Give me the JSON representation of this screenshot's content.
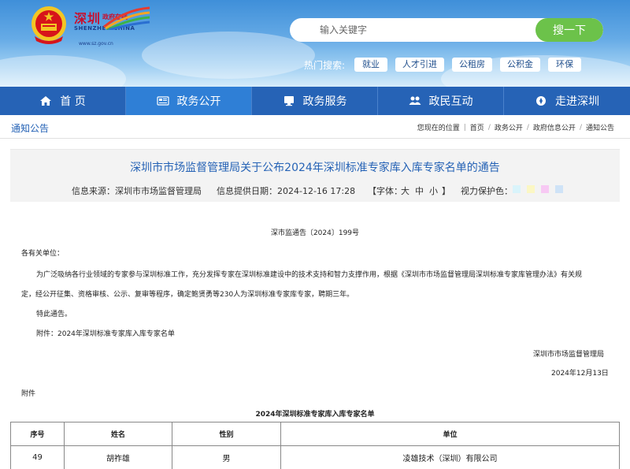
{
  "header": {
    "logo_cn": "深圳",
    "logo_cn_small": "政府在线",
    "logo_en": "SHENZHEN CHINA",
    "logo_url": "www.sz.gov.cn",
    "search_placeholder": "输入关键字",
    "search_button": "搜一下",
    "hot_label": "热门搜索:",
    "hot_tags": [
      "就业",
      "人才引进",
      "公租房",
      "公积金",
      "环保"
    ]
  },
  "nav": [
    {
      "label": "首 页",
      "icon": "home-icon"
    },
    {
      "label": "政务公开",
      "icon": "news-icon"
    },
    {
      "label": "政务服务",
      "icon": "monitor-icon"
    },
    {
      "label": "政民互动",
      "icon": "users-icon"
    },
    {
      "label": "走进深圳",
      "icon": "compass-icon"
    }
  ],
  "breadcrumb": {
    "section_title": "通知公告",
    "label": "您现在的位置",
    "items": [
      "首页",
      "政务公开",
      "政府信息公开",
      "通知公告"
    ]
  },
  "article": {
    "title": "深圳市市场监督管理局关于公布2024年深圳标准专家库入库专家名单的通告",
    "source": "信息来源：深圳市市场监督管理局",
    "date": "信息提供日期：2024-12-16 17:28",
    "font_label": "【字体：",
    "font_large": "大",
    "font_medium": "中",
    "font_small": "小",
    "font_close": "】",
    "eye_label": "视力保护色：",
    "eye_colors": [
      "#d9f4fb",
      "#fbf7c4",
      "#f7c9f3",
      "#cfe3f7",
      "#8dbbec"
    ],
    "doc_no": "深市监通告〔2024〕199号",
    "greeting": "各有关单位：",
    "para1_line1": "为广泛吸纳各行业领域的专家参与深圳标准工作，充分发挥专家在深圳标准建设中的技术支持和智力支撑作用，根据《深圳市市场监督管理局深圳标准专家库管理办法》有关规",
    "para1_line2": "定，经公开征集、资格审核、公示、复审等程序，确定鲍贤勇等230人为深圳标准专家库专家，聘期三年。",
    "notice": "特此通告。",
    "attachment": "附件：2024年深圳标准专家库入库专家名单",
    "signer": "深圳市市场监督管理局",
    "sign_date": "2024年12月13日",
    "attachment_heading": "附件",
    "table_title": "2024年深圳标准专家库入库专家名单"
  },
  "table": {
    "headers": [
      "序号",
      "姓名",
      "性别",
      "单位"
    ],
    "rows": [
      [
        "49",
        "胡祚雄",
        "男",
        "凌雄技术（深圳）有限公司"
      ]
    ]
  },
  "colors": {
    "nav_bg": "#2663b6",
    "nav_active": "#2f7fd6",
    "search_btn": "#6cc24a",
    "title_blue": "#2663b6"
  }
}
